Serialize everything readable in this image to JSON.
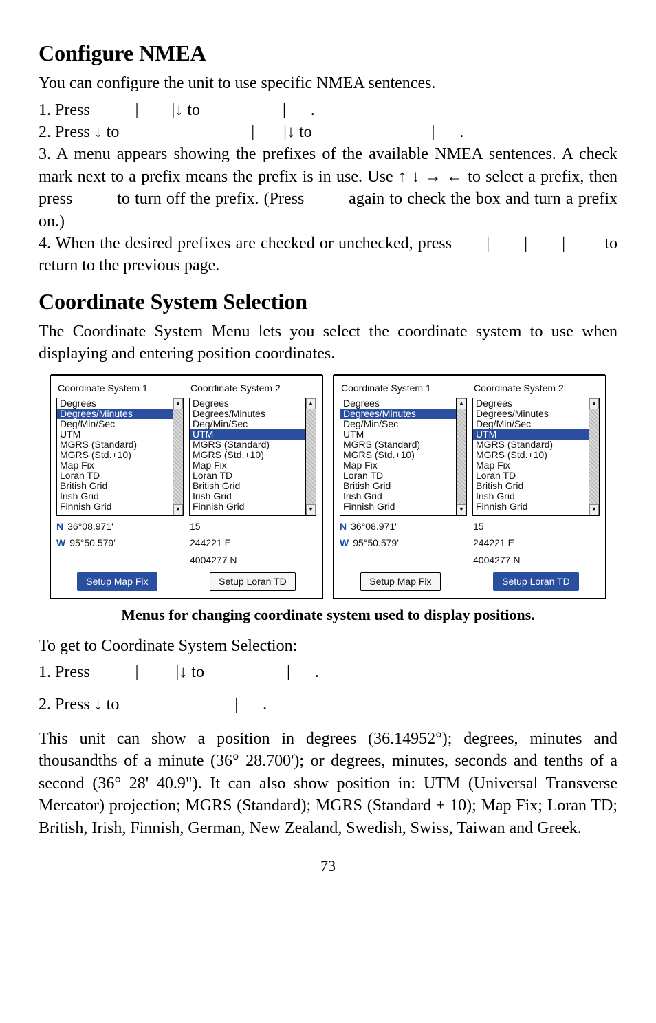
{
  "h1": "Configure NMEA",
  "p1": "You can configure the unit to use specific NMEA sentences.",
  "s1": "1. Press           |        |↓ to                    |      .",
  "s2": "2. Press ↓ to                                |       |↓ to                             |      .",
  "s3": "3. A menu appears showing the prefixes of the available NMEA sentences. A check mark next to a prefix means the prefix is in use. Use ↑ ↓ → ← to select a prefix, then press         to turn off the prefix. (Press         again to check the box and turn a prefix on.)",
  "s4": "4. When the desired prefixes are checked or unchecked, press       |       |       |        to return to the previous page.",
  "h2": "Coordinate System Selection",
  "p2": "The Coordinate System Menu lets you select the coordinate system to use when displaying and entering position coordinates.",
  "coordItems": [
    "Degrees",
    "Degrees/Minutes",
    "Deg/Min/Sec",
    "UTM",
    "MGRS (Standard)",
    "MGRS (Std.+10)",
    "Map Fix",
    "Loran TD",
    "British Grid",
    "Irish Grid",
    "Finnish Grid"
  ],
  "leftShot": {
    "col1Title": "Coordinate System 1",
    "col1Sel": 1,
    "col2Title": "Coordinate System 2",
    "col2Sel": 3,
    "lat": "36°08.971'",
    "lon": "95°50.579'",
    "zone": "15",
    "east": "244221 E",
    "north": "4004277 N",
    "btn1": "Setup Map Fix",
    "btn2": "Setup Loran TD",
    "selBtn": 1
  },
  "rightShot": {
    "col1Title": "Coordinate System 1",
    "col1Sel": 1,
    "col2Title": "Coordinate System 2",
    "col2Sel": 3,
    "lat": "36°08.971'",
    "lon": "95°50.579'",
    "zone": "15",
    "east": "244221 E",
    "north": "4004277 N",
    "btn1": "Setup Map Fix",
    "btn2": "Setup Loran TD",
    "selBtn": 2
  },
  "caption": "Menus for changing coordinate system used to display positions.",
  "p3": "To get to Coordinate System Selection:",
  "s5": "1. Press           |         |↓ to                    |      .",
  "s6": "2. Press ↓ to                            |      .",
  "p4": "This unit can show a position in degrees (36.14952°); degrees, minutes and thousandths of a minute (36° 28.700'); or degrees, minutes, seconds and tenths of a second (36° 28' 40.9\"). It can also show position in: UTM (Universal Transverse Mercator) projection; MGRS (Standard); MGRS (Standard + 10); Map Fix; Loran TD; British, Irish, Finnish, German, New Zealand, Swedish, Swiss, Taiwan and Greek.",
  "pageNum": "73"
}
